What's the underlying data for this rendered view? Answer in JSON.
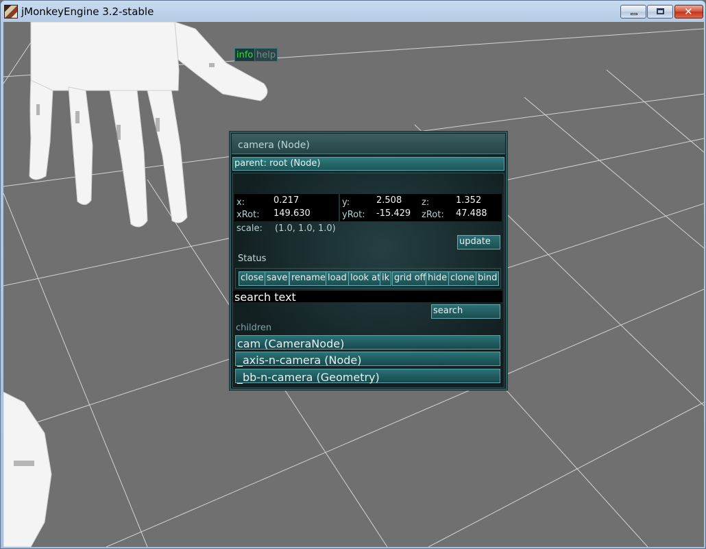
{
  "window": {
    "title": "jMonkeyEngine 3.2-stable"
  },
  "panel": {
    "title": "camera (Node)",
    "parent": "parent: root (Node)",
    "tabs": [
      "info",
      "help"
    ],
    "fields": {
      "x_label": "x:",
      "x": "0.217",
      "y_label": "y:",
      "y": "2.508",
      "z_label": "z:",
      "z": "1.352",
      "xrot_label": "xRot:",
      "xrot": "149.630",
      "yrot_label": "yRot:",
      "yrot": "-15.429",
      "zrot_label": "zRot:",
      "zrot": "47.488",
      "scale_label": "scale:",
      "scale": "(1.0, 1.0, 1.0)"
    },
    "update_label": "update",
    "status_label": "Status",
    "actions": [
      "close",
      "save",
      "rename",
      "load",
      "look at",
      "ik",
      "grid off",
      "hide",
      "clone",
      "bind"
    ],
    "search_text": "search text",
    "search_label": "search",
    "children_label": "children",
    "children": [
      "cam (CameraNode)",
      "_axis-n-camera (Node)",
      "_bb-n-camera (Geometry)"
    ]
  }
}
